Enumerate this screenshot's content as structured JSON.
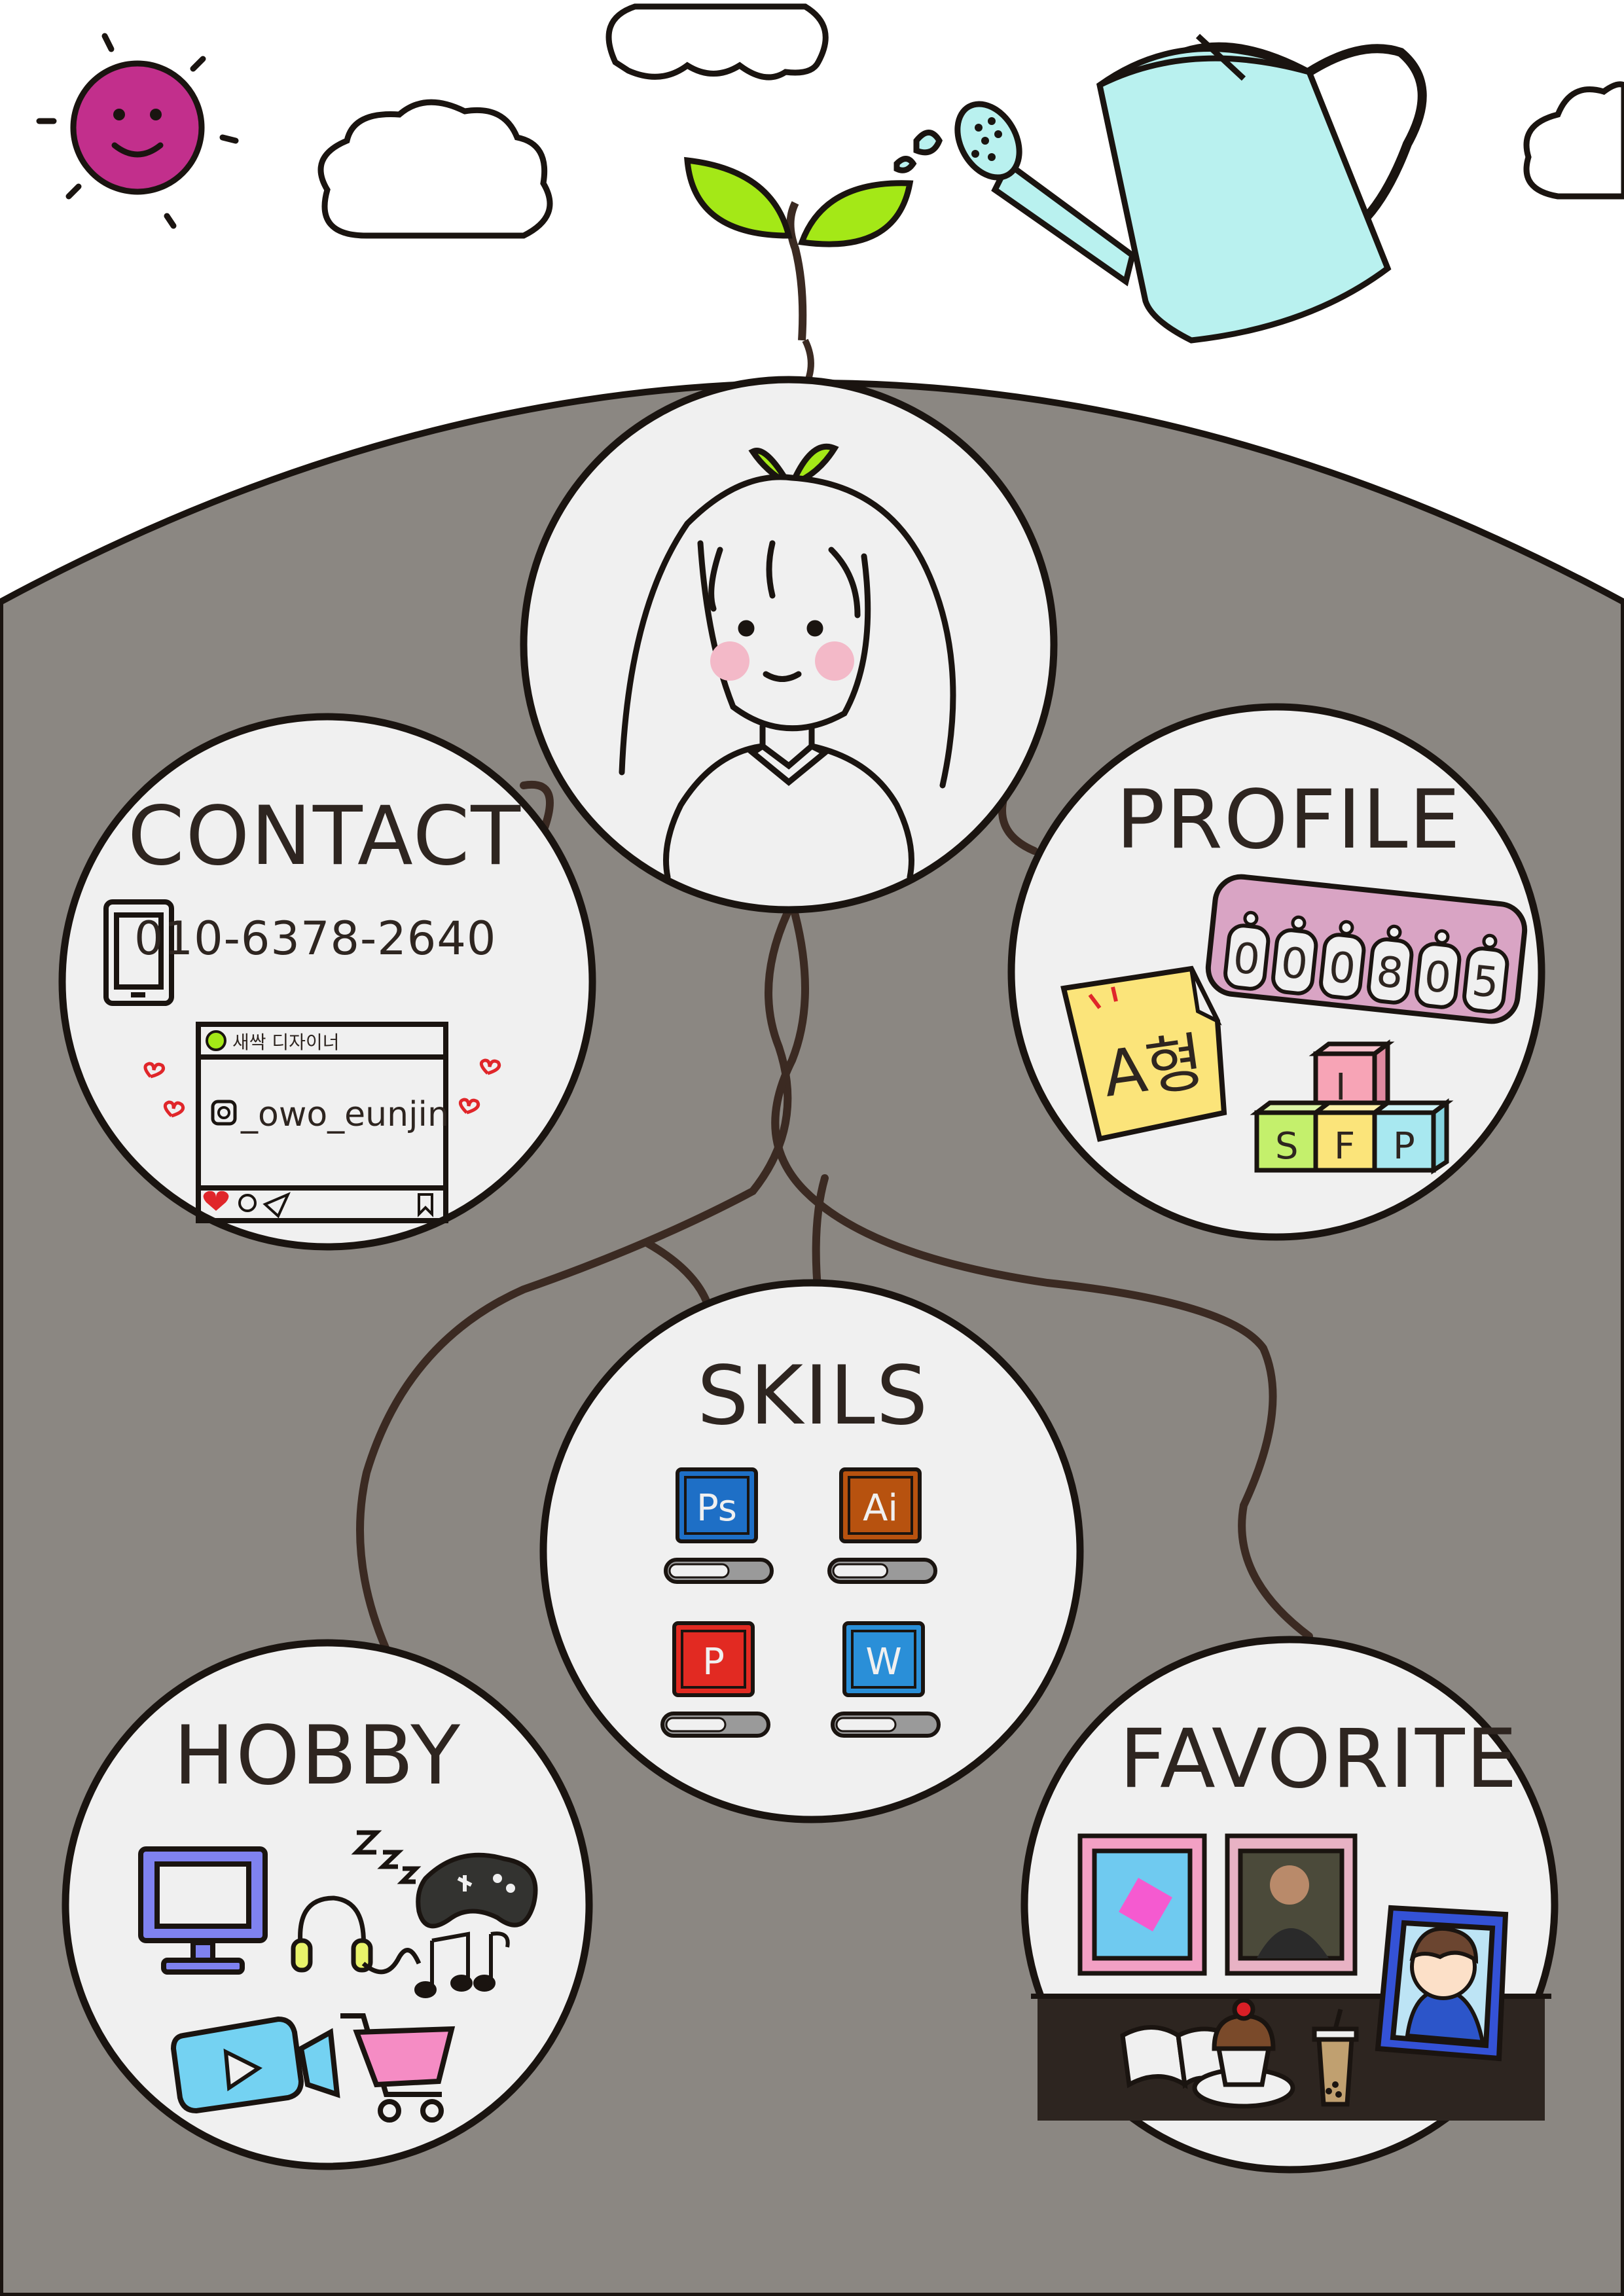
{
  "sections": {
    "contact": "CONTACT",
    "profile": "PROFILE",
    "skills": "SKILS",
    "hobby": "HOBBY",
    "favorite": "FAVORITE"
  },
  "contact": {
    "phone": "010-6378-2640",
    "post_caption": "새싹 디자이너",
    "instagram": "_owo_eunjin"
  },
  "profile": {
    "birth_digits": [
      "0",
      "0",
      "0",
      "8",
      "0",
      "5"
    ],
    "blood_type": "A형",
    "mbti_top": "I",
    "mbti_bottom": [
      "S",
      "F",
      "P"
    ]
  },
  "skills": [
    {
      "icon": "Ps",
      "level": 0.6,
      "color": "#1e6fc6"
    },
    {
      "icon": "Ai",
      "level": 0.55,
      "color": "#b7520f"
    },
    {
      "icon": "P",
      "level": 0.6,
      "color": "#e22a22"
    },
    {
      "icon": "W",
      "level": 0.6,
      "color": "#2a8fd8"
    }
  ],
  "colors": {
    "background_ground": "#8b8782",
    "circle_fill": "#f0f0f0",
    "root_stroke": "#3b2a22",
    "leaf_green": "#a4e817",
    "sun": "#c22f8c",
    "watering_can": "#b9f1ef",
    "ticket_pink": "#d9a4c4"
  },
  "icons": [
    "sun-icon",
    "cloud-icon",
    "sprout-icon",
    "watering-can-icon",
    "phone-icon",
    "instagram-icon",
    "heart-icon",
    "monitor-icon",
    "gamepad-icon",
    "headphones-icon",
    "music-note-icon",
    "video-camera-icon",
    "shopping-cart-icon",
    "book-icon",
    "cupcake-icon",
    "coffee-icon",
    "photo-frame-icon"
  ]
}
